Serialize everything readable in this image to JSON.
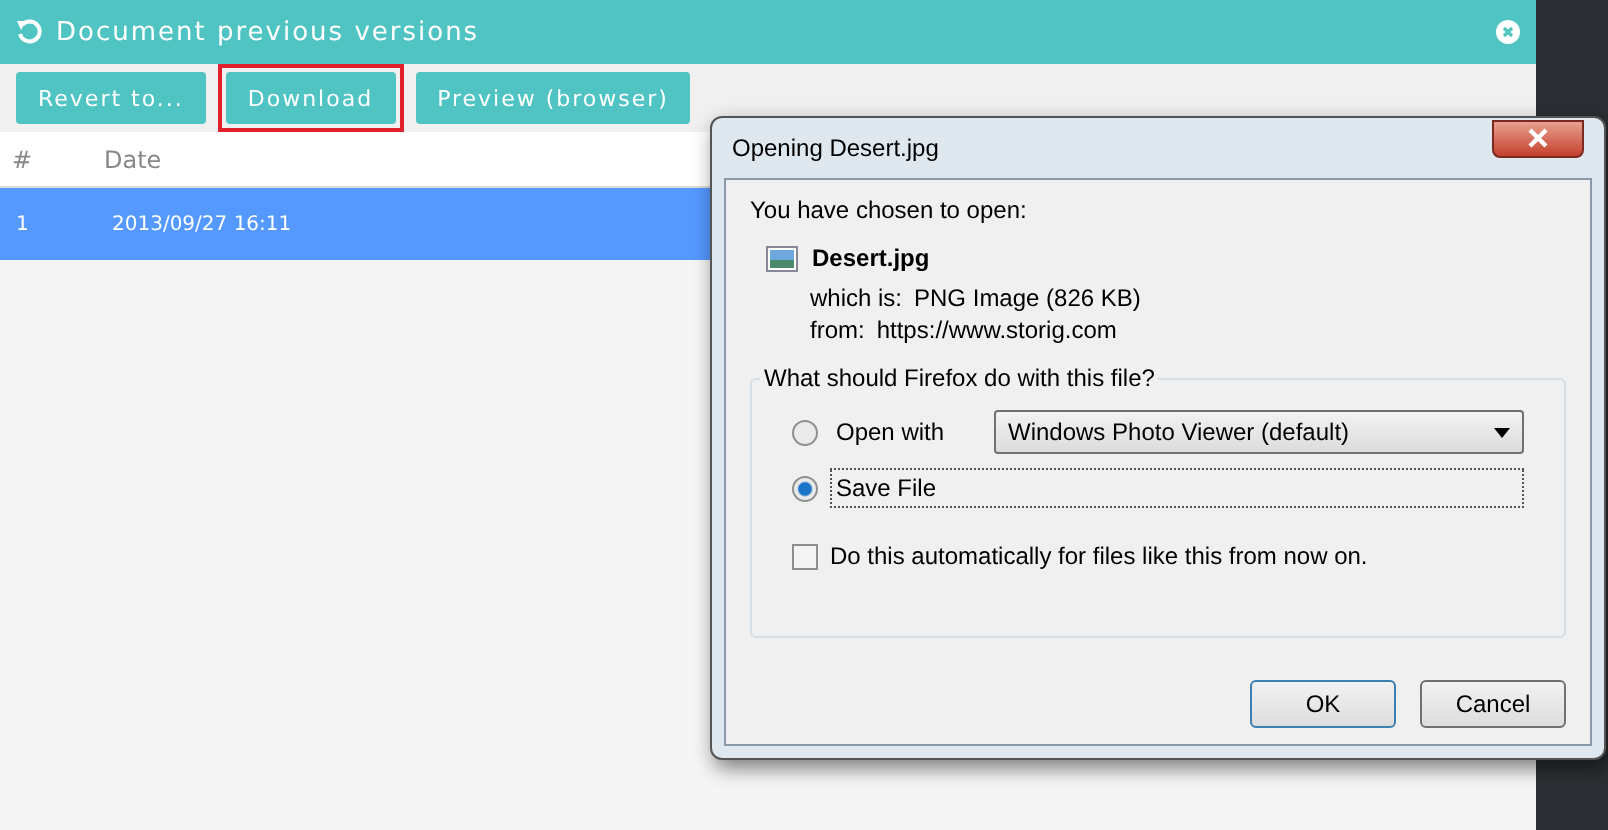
{
  "window": {
    "title": "Document previous versions"
  },
  "toolbar": {
    "buttons": [
      {
        "label": "Revert to...",
        "highlighted": false
      },
      {
        "label": "Download",
        "highlighted": true
      },
      {
        "label": "Preview (browser)",
        "highlighted": false
      }
    ]
  },
  "table": {
    "columns": [
      "#",
      "Date"
    ],
    "rows": [
      {
        "cells": [
          "1",
          "2013/09/27 16:11"
        ],
        "selected": true
      }
    ]
  },
  "dialog": {
    "title": "Opening Desert.jpg",
    "intro": "You have chosen to open:",
    "file_name": "Desert.jpg",
    "details": [
      {
        "label": "which is:",
        "value": "PNG Image (826 KB)"
      },
      {
        "label": "from:",
        "value": "https://www.storig.com"
      }
    ],
    "group_title": "What should Firefox do with this file?",
    "options": [
      {
        "label": "Open with",
        "selected": false,
        "app": "Windows Photo Viewer (default)"
      },
      {
        "label": "Save File",
        "selected": true
      }
    ],
    "auto_checkbox": {
      "label": "Do this automatically for files like this from now on.",
      "checked": false
    },
    "buttons": [
      {
        "label": "OK",
        "default": true
      },
      {
        "label": "Cancel",
        "default": false
      }
    ]
  }
}
